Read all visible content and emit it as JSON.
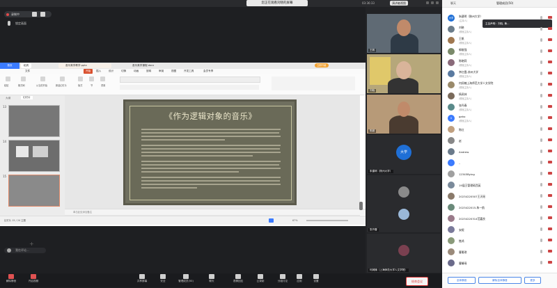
{
  "meeting": {
    "share_banner": "您正在观看刘晓的屏幕",
    "timer": "03:36:33",
    "gallery_button": "演讲者视图",
    "recording_label": "录制中",
    "lock_label": "锁定画面",
    "end_button": "结束会议"
  },
  "shared_window": {
    "home_tab": "首页",
    "login_tab": "稻壳",
    "doc_tab": "音乐美学教学.pptx",
    "doc_tab2": "音乐美学课程.docx",
    "upgrade_label": "立即升级",
    "menus": [
      "开始",
      "插入",
      "设计",
      "切换",
      "动画",
      "放映",
      "审阅",
      "视图",
      "开发工具",
      "会员专享",
      "文件"
    ],
    "ribbon": [
      "粘贴",
      "格式刷",
      "从当前开始",
      "新建幻灯片",
      "版式",
      "节",
      "重置"
    ],
    "panel_tabs": [
      "大纲",
      "幻灯片"
    ],
    "slide_numbers": [
      "13",
      "14",
      "15"
    ],
    "slide_title": "《作为逻辑对象的音乐》",
    "notes_placeholder": "单击此处添加备注",
    "status_text": "幻灯片 15 / 24   主题",
    "zoom": "67%"
  },
  "chat_preview": "我在评论...",
  "toolbar": [
    {
      "label": "解除静音",
      "icon": "mic-icon"
    },
    {
      "label": "开启视频",
      "icon": "camera-icon"
    },
    {
      "label": "共享屏幕",
      "icon": "share-icon"
    },
    {
      "label": "安全",
      "icon": "shield-icon"
    },
    {
      "label": "管理成员(50)",
      "icon": "members-icon"
    },
    {
      "label": "聊天",
      "icon": "chat-icon"
    },
    {
      "label": "表情回应",
      "icon": "emoji-icon"
    },
    {
      "label": "云录制",
      "icon": "record-icon"
    },
    {
      "label": "分组讨论",
      "icon": "group-icon"
    },
    {
      "label": "应用",
      "icon": "apps-icon"
    },
    {
      "label": "设置",
      "icon": "settings-icon"
    }
  ],
  "videos": [
    {
      "name": "王帆"
    },
    {
      "name": "刘晓"
    },
    {
      "name": "陈超"
    },
    {
      "name": "朱建明（陕州大学）",
      "avatar": "大学"
    },
    {
      "name": "鲍国瑜"
    },
    {
      "name": "张丹春"
    },
    {
      "name": "何润楠（上海师范大学人文学院）"
    }
  ],
  "right_panel": {
    "chat_tab": "聊天",
    "title": "管理成员(50)",
    "hint": "主会声明：刘晓, 黄...",
    "participants": [
      {
        "name": "朱建明（陕州大学）",
        "role": "(主持人)",
        "av": "大学"
      },
      {
        "name": "刘晓",
        "role": "(联席主持人)",
        "av": ""
      },
      {
        "name": "王帆",
        "role": "(联席主持人)",
        "av": ""
      },
      {
        "name": "郭维强",
        "role": "(联席主持人)",
        "av": ""
      },
      {
        "name": "陈晓莉",
        "role": "(联席主持人)",
        "av": ""
      },
      {
        "name": "李红霞-苏州大学",
        "role": "(联席主持人)",
        "av": ""
      },
      {
        "name": "何润楠上海师范大学人文学院",
        "role": "(联席主持人)",
        "av": ""
      },
      {
        "name": "杨凤林",
        "role": "(联席主持人)",
        "av": ""
      },
      {
        "name": "张丹春",
        "role": "(联席主持人)",
        "av": ""
      },
      {
        "name": "gaho",
        "role": "(联席主持人)",
        "av": "G"
      },
      {
        "name": "陈红",
        "role": "",
        "av": ""
      },
      {
        "name": "赵",
        "role": "",
        "av": ""
      },
      {
        "name": "Andrew",
        "role": "",
        "av": ""
      },
      {
        "name": "..",
        "role": "",
        "av": "."
      },
      {
        "name": "12345Bying",
        "role": "",
        "av": ""
      },
      {
        "name": "19届王管理硕西英",
        "role": "",
        "av": ""
      },
      {
        "name": "20234220507王天瑶",
        "role": "",
        "av": ""
      },
      {
        "name": "2023422015-朱一航",
        "role": "",
        "av": ""
      },
      {
        "name": "20234220314范嘉良",
        "role": "",
        "av": ""
      },
      {
        "name": "安妮",
        "role": "",
        "av": ""
      },
      {
        "name": "鲍鸿",
        "role": "",
        "av": ""
      },
      {
        "name": "曹雅琪",
        "role": "",
        "av": ""
      },
      {
        "name": "曹馨瑶",
        "role": "",
        "av": ""
      }
    ],
    "footer": [
      "全体静音",
      "解除全体静音",
      "更多"
    ]
  }
}
